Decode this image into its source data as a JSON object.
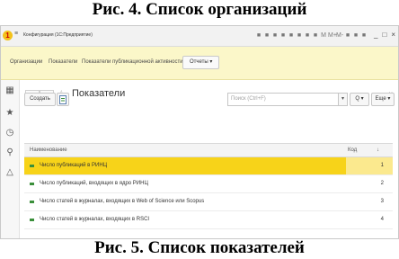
{
  "captions": {
    "top": "Рис. 4. Список организаций",
    "bottom": "Рис. 5. Список показателей"
  },
  "titlebar": {
    "menu_glyph": "≡",
    "title": "Конфигурация (1С:Предприятие)",
    "toolbar_icons": [
      "■",
      "■",
      "■",
      "■",
      "■",
      "■",
      "■",
      "■",
      "M",
      "M+",
      "M-",
      "■",
      "■",
      "■",
      "■",
      "■",
      "■"
    ],
    "window_controls": [
      "_",
      "□",
      "×"
    ]
  },
  "sections": {
    "items": [
      "Организации",
      "Показатели",
      "Показатели публикационной активности"
    ],
    "reports_button": "Отчеты ▾"
  },
  "leftbar": {
    "icons": [
      "apps-icon",
      "star-icon",
      "history-icon",
      "search-icon",
      "bell-icon"
    ]
  },
  "form": {
    "back": "←",
    "forward": "→",
    "title": "Показатели",
    "close": "×",
    "create_button": "Создать",
    "search_placeholder": "Поиск (Ctrl+F)",
    "search_dropdown": "▾",
    "find_button": "Q ▾",
    "more_button": "Еще ▾",
    "columns": {
      "name": "Наименование",
      "code": "Код",
      "sort": "↓"
    },
    "rows": [
      {
        "name": "Число публикаций в РИНЦ",
        "code": "1",
        "selected": true
      },
      {
        "name": "Число публикаций, входящих в ядро РИНЦ",
        "code": "2",
        "selected": false
      },
      {
        "name": "Число статей в журналах, входящих в Web of Science или Scopus",
        "code": "3",
        "selected": false
      },
      {
        "name": "Число статей в журналах, входящих в RSCI",
        "code": "4",
        "selected": false
      }
    ]
  },
  "colors": {
    "sections_bg": "#fbf7c9",
    "selected_row": "#f7d319",
    "marker": "#3a8f3a"
  }
}
